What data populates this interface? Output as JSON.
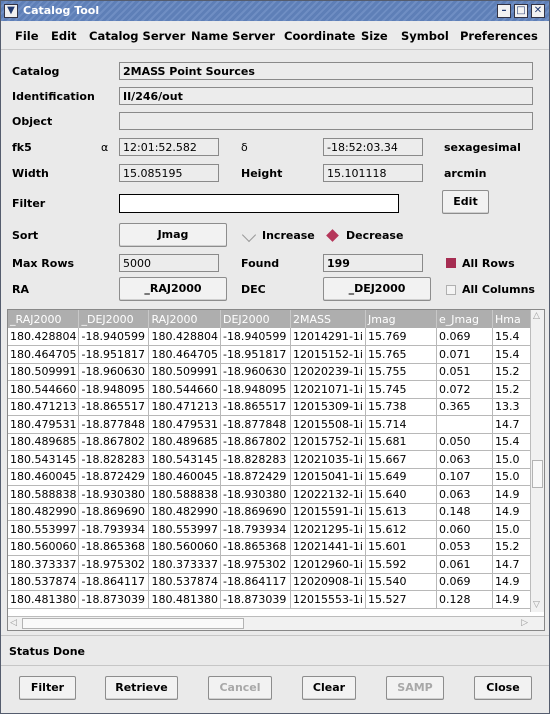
{
  "window": {
    "title": "Catalog Tool",
    "menu_icon": "chevron-down-icon"
  },
  "menu": [
    "File",
    "Edit",
    "Catalog Server",
    "Name Server",
    "Coordinate",
    "Size",
    "Symbol",
    "Preferences"
  ],
  "form": {
    "catalog_label": "Catalog",
    "catalog_value": "2MASS Point Sources",
    "identification_label": "Identification",
    "identification_value": "II/246/out",
    "object_label": "Object",
    "object_value": "",
    "system_label": "fk5",
    "alpha_symbol": "α",
    "ra_value": "12:01:52.582",
    "delta_symbol": "δ",
    "dec_value": "-18:52:03.34",
    "format_label": "sexagesimal",
    "width_label": "Width",
    "width_value": "15.085195",
    "height_label": "Height",
    "height_value": "15.101118",
    "size_unit": "arcmin",
    "filter_label": "Filter",
    "filter_value": "",
    "edit_button": "Edit",
    "sort_label": "Sort",
    "sort_column": "Jmag",
    "increase_label": "Increase",
    "decrease_label": "Decrease",
    "sort_order": "Decrease",
    "maxrows_label": "Max Rows",
    "maxrows_value": "5000",
    "found_label": "Found",
    "found_value": "199",
    "allrows_label": "All Rows",
    "allrows_checked": true,
    "ra_label": "RA",
    "ra_column": "_RAJ2000",
    "dec_label": "DEC",
    "dec_column": "_DEJ2000",
    "allcolumns_label": "All Columns",
    "allcolumns_checked": false
  },
  "table": {
    "headers": [
      "_RAJ2000",
      "_DEJ2000",
      "RAJ2000",
      "DEJ2000",
      "2MASS",
      "Jmag",
      "e_Jmag",
      "Hma"
    ],
    "rows": [
      [
        "180.428804",
        "-18.940599",
        "180.428804",
        "-18.940599",
        "12014291-1i",
        "15.769",
        "0.069",
        "15.4"
      ],
      [
        "180.464705",
        "-18.951817",
        "180.464705",
        "-18.951817",
        "12015152-1i",
        "15.765",
        "0.071",
        "15.4"
      ],
      [
        "180.509991",
        "-18.960630",
        "180.509991",
        "-18.960630",
        "12020239-1i",
        "15.755",
        "0.051",
        "15.2"
      ],
      [
        "180.544660",
        "-18.948095",
        "180.544660",
        "-18.948095",
        "12021071-1i",
        "15.745",
        "0.072",
        "15.2"
      ],
      [
        "180.471213",
        "-18.865517",
        "180.471213",
        "-18.865517",
        "12015309-1i",
        "15.738",
        "0.365",
        "13.3"
      ],
      [
        "180.479531",
        "-18.877848",
        "180.479531",
        "-18.877848",
        "12015508-1i",
        "15.714",
        "",
        "14.7"
      ],
      [
        "180.489685",
        "-18.867802",
        "180.489685",
        "-18.867802",
        "12015752-1i",
        "15.681",
        "0.050",
        "15.4"
      ],
      [
        "180.543145",
        "-18.828283",
        "180.543145",
        "-18.828283",
        "12021035-1i",
        "15.667",
        "0.063",
        "15.0"
      ],
      [
        "180.460045",
        "-18.872429",
        "180.460045",
        "-18.872429",
        "12015041-1i",
        "15.649",
        "0.107",
        "15.0"
      ],
      [
        "180.588838",
        "-18.930380",
        "180.588838",
        "-18.930380",
        "12022132-1i",
        "15.640",
        "0.063",
        "14.9"
      ],
      [
        "180.482990",
        "-18.869690",
        "180.482990",
        "-18.869690",
        "12015591-1i",
        "15.613",
        "0.148",
        "14.9"
      ],
      [
        "180.553997",
        "-18.793934",
        "180.553997",
        "-18.793934",
        "12021295-1i",
        "15.612",
        "0.060",
        "15.0"
      ],
      [
        "180.560060",
        "-18.865368",
        "180.560060",
        "-18.865368",
        "12021441-1i",
        "15.601",
        "0.053",
        "15.2"
      ],
      [
        "180.373337",
        "-18.975302",
        "180.373337",
        "-18.975302",
        "12012960-1i",
        "15.592",
        "0.061",
        "14.7"
      ],
      [
        "180.537874",
        "-18.864117",
        "180.537874",
        "-18.864117",
        "12020908-1i",
        "15.540",
        "0.069",
        "14.9"
      ],
      [
        "180.481380",
        "-18.873039",
        "180.481380",
        "-18.873039",
        "12015553-1i",
        "15.527",
        "0.128",
        "14.9"
      ]
    ]
  },
  "status": {
    "label": "Status",
    "value": "Done"
  },
  "buttons": {
    "filter": "Filter",
    "retrieve": "Retrieve",
    "cancel": "Cancel",
    "clear": "Clear",
    "samp": "SAMP",
    "close": "Close"
  }
}
